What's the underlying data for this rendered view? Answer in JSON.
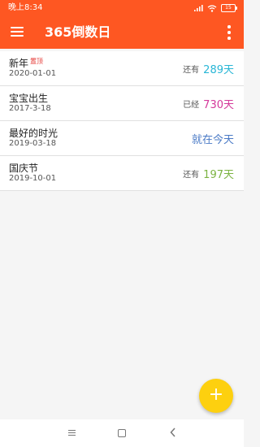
{
  "status_bar": {
    "time": "晚上8:34",
    "battery": "15"
  },
  "app_bar": {
    "title": "365倒数日",
    "menu_icon": "menu-icon",
    "more_icon": "more-vert-icon"
  },
  "events": [
    {
      "name": "新年",
      "badge": "置顶",
      "date": "2020-01-01",
      "prefix": "还有",
      "count": "289天",
      "color": "#29b6d6"
    },
    {
      "name": "宝宝出生",
      "badge": "",
      "date": "2017-3-18",
      "prefix": "已经",
      "count": "730天",
      "color": "#d4389a"
    },
    {
      "name": "最好的时光",
      "badge": "",
      "date": "2019-03-18",
      "prefix": "",
      "count": "就在今天",
      "color": "#4a7ac6"
    },
    {
      "name": "国庆节",
      "badge": "",
      "date": "2019-10-01",
      "prefix": "还有",
      "count": "197天",
      "color": "#7cb342"
    }
  ],
  "fab": {
    "label": "+",
    "color": "#fdd00f"
  },
  "colors": {
    "primary": "#fe5722",
    "pin_badge": "#e53935"
  },
  "nav_icons": [
    "recents-icon",
    "home-icon",
    "back-icon"
  ]
}
